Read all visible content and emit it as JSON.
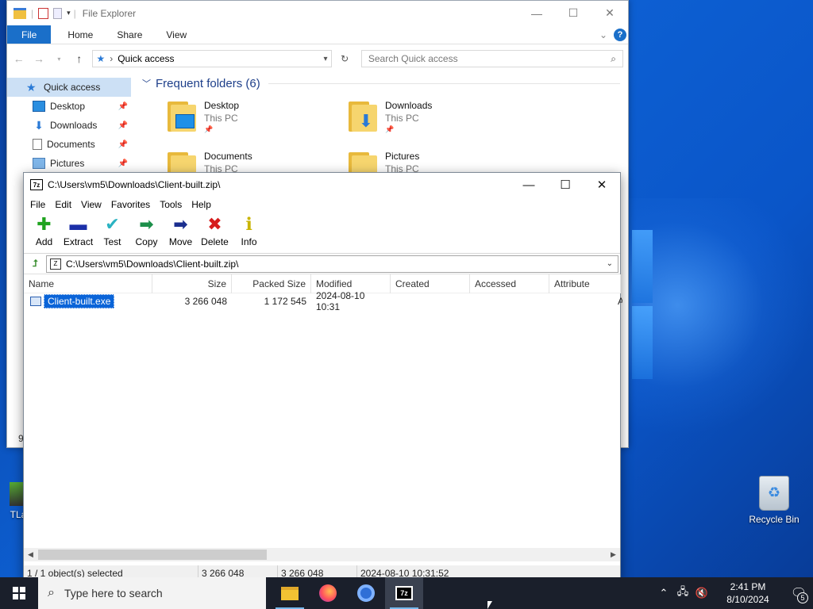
{
  "desktop": {
    "recycle_bin_label": "Recycle Bin",
    "left_icon_label": "TLa"
  },
  "file_explorer": {
    "title": "File Explorer",
    "ribbon_tabs": [
      "File",
      "Home",
      "Share",
      "View"
    ],
    "help_label": "?",
    "address": "Quick access",
    "search_placeholder": "Search Quick access",
    "nav_items": [
      {
        "label": "Quick access"
      },
      {
        "label": "Desktop"
      },
      {
        "label": "Downloads"
      },
      {
        "label": "Documents"
      },
      {
        "label": "Pictures"
      }
    ],
    "group_title": "Frequent folders (6)",
    "folders": [
      {
        "name": "Desktop",
        "location": "This PC"
      },
      {
        "name": "Downloads",
        "location": "This PC"
      },
      {
        "name": "Documents",
        "location": "This PC"
      },
      {
        "name": "Pictures",
        "location": "This PC"
      }
    ],
    "status_fragment": "9"
  },
  "sevenzip": {
    "title": "C:\\Users\\vm5\\Downloads\\Client-built.zip\\",
    "menu": [
      "File",
      "Edit",
      "View",
      "Favorites",
      "Tools",
      "Help"
    ],
    "toolbar": [
      {
        "label": "Add",
        "icon": "plus-icon",
        "color": "#1fa31f",
        "glyph": "✚"
      },
      {
        "label": "Extract",
        "icon": "minus-icon",
        "color": "#1b2fa8",
        "glyph": "▬"
      },
      {
        "label": "Test",
        "icon": "check-icon",
        "color": "#2bb3c2",
        "glyph": "✔"
      },
      {
        "label": "Copy",
        "icon": "copy-arrows-icon",
        "color": "#1c8f4a",
        "glyph": "➡"
      },
      {
        "label": "Move",
        "icon": "move-arrow-icon",
        "color": "#1b2f8f",
        "glyph": "➡"
      },
      {
        "label": "Delete",
        "icon": "delete-x-icon",
        "color": "#d61c1c",
        "glyph": "✖"
      },
      {
        "label": "Info",
        "icon": "info-icon",
        "color": "#c9b400",
        "glyph": "ℹ"
      }
    ],
    "path": "C:\\Users\\vm5\\Downloads\\Client-built.zip\\",
    "columns": [
      "Name",
      "Size",
      "Packed Size",
      "Modified",
      "Created",
      "Accessed",
      "Attribute"
    ],
    "rows": [
      {
        "name": "Client-built.exe",
        "size": "3 266 048",
        "packed": "1 172 545",
        "modified": "2024-08-10 10:31",
        "created": "",
        "accessed": "",
        "attr": "A"
      }
    ],
    "status": {
      "selected": "1 / 1 object(s) selected",
      "size": "3 266 048",
      "packed": "3 266 048",
      "modified": "2024-08-10 10:31:52"
    }
  },
  "taskbar": {
    "search_placeholder": "Type here to search",
    "apps": [
      "File Explorer",
      "Firefox",
      "Chromium",
      "7-Zip"
    ],
    "time": "2:41 PM",
    "date": "8/10/2024",
    "notification_count": "5"
  }
}
